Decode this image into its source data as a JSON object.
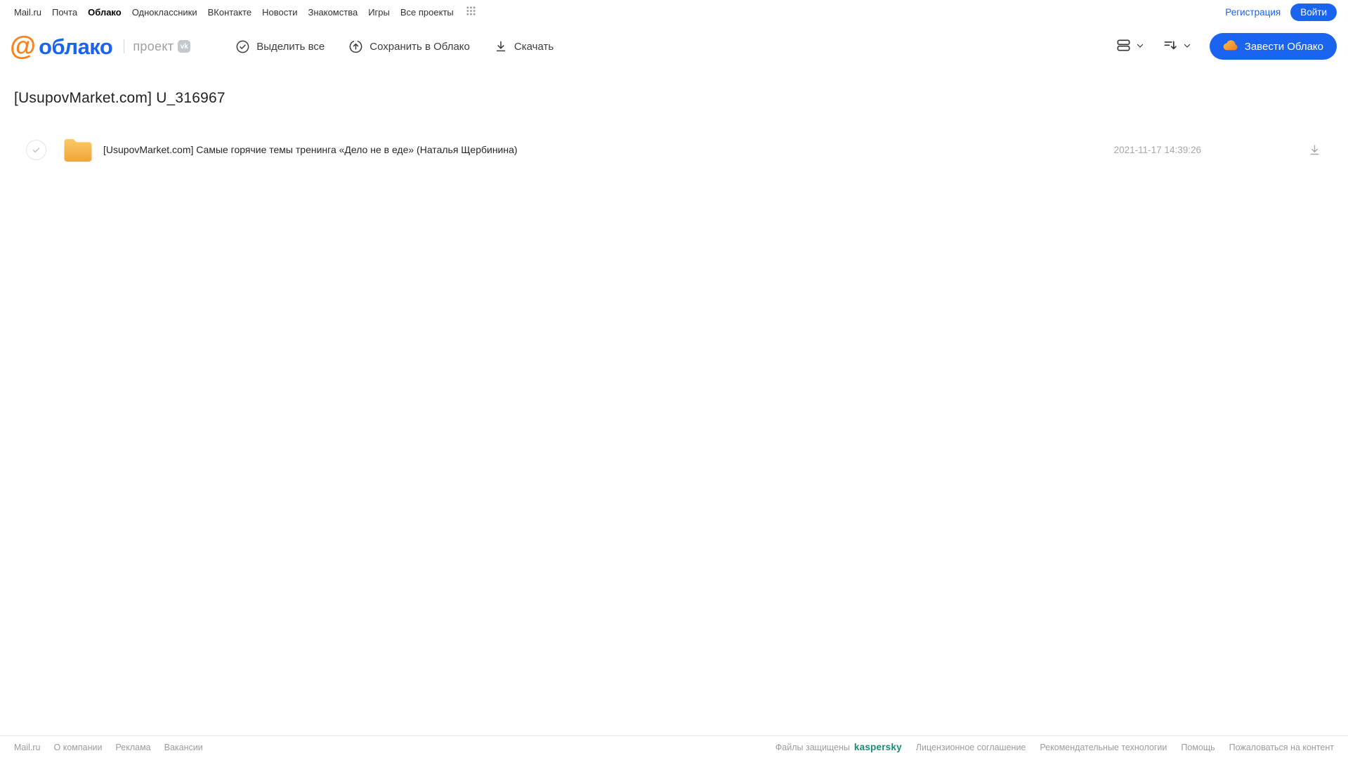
{
  "topbar": {
    "links": [
      "Mail.ru",
      "Почта",
      "Облако",
      "Одноклассники",
      "ВКонтакте",
      "Новости",
      "Знакомства",
      "Игры",
      "Все проекты"
    ],
    "registration_label": "Регистрация",
    "login_label": "Войти"
  },
  "header": {
    "logo_at": "@",
    "logo_text": "облако",
    "project_label": "проект",
    "project_badge": "vk",
    "actions": [
      {
        "label": "Выделить все"
      },
      {
        "label": "Сохранить в Облако"
      },
      {
        "label": "Скачать"
      }
    ],
    "create_cloud_label": "Завести Облако"
  },
  "page": {
    "title": "[UsupovMarket.com] U_316967"
  },
  "files": [
    {
      "type": "folder",
      "name": "[UsupovMarket.com] Самые горячие темы тренинга «Дело не в еде» (Наталья Щербинина)",
      "date": "2021-11-17 14:39:26"
    }
  ],
  "footer": {
    "left_links": [
      "Mail.ru",
      "О компании",
      "Реклама",
      "Вакансии"
    ],
    "protected_text": "Файлы защищены",
    "kaspersky_label": "kaspersky",
    "right_links": [
      "Лицензионное соглашение",
      "Рекомендательные технологии",
      "Помощь",
      "Пожаловаться на контент"
    ]
  },
  "colors": {
    "accent_blue": "#1a64f0",
    "logo_orange": "#f8821f",
    "folder_top": "#fcca66",
    "folder_bottom": "#f0a43c",
    "kaspersky_green": "#1d8a72"
  }
}
